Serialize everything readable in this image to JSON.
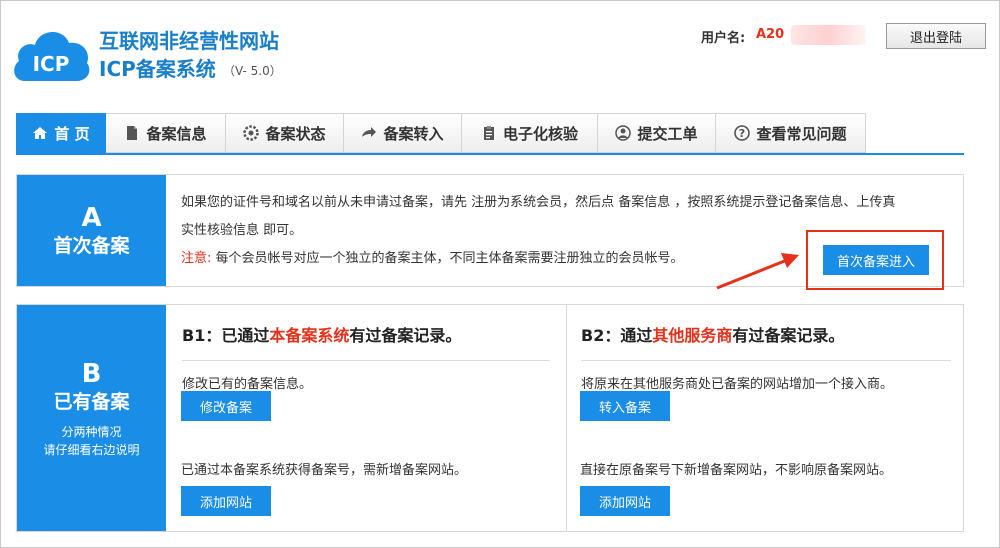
{
  "header": {
    "logo_text": "ICP",
    "site_title": "互联网非经营性网站",
    "system_title": "ICP备案系统",
    "version": "（V- 5.0）",
    "user_label": "用户名:",
    "user_value": "A20",
    "logout_label": "退出登陆"
  },
  "tabs": [
    {
      "label": "首 页",
      "icon": "home-icon"
    },
    {
      "label": "备案信息",
      "icon": "document-icon"
    },
    {
      "label": "备案状态",
      "icon": "gear-icon"
    },
    {
      "label": "备案转入",
      "icon": "arrow-right-icon"
    },
    {
      "label": "电子化核验",
      "icon": "clipboard-icon"
    },
    {
      "label": "提交工单",
      "icon": "user-icon"
    },
    {
      "label": "查看常见问题",
      "icon": "question-icon"
    }
  ],
  "section_a": {
    "letter": "A",
    "title": "首次备案",
    "line1": "如果您的证件号和域名以前从未申请过备案，请先 注册为系统会员，然后点 备案信息 ，按照系统提示登记备案信息、上传真",
    "line2": "实性核验信息 即可。",
    "note_label": "注意:",
    "note_text": " 每个会员帐号对应一个独立的备案主体，不同主体备案需要注册独立的会员帐号。",
    "button": "首次备案进入"
  },
  "section_b": {
    "letter": "B",
    "title": "已有备案",
    "note1": "分两种情况",
    "note2": "请仔细看右边说明",
    "b1": {
      "title_prefix": "B1：已通过",
      "title_highlight": "本备案系统",
      "title_suffix": "有过备案记录。",
      "desc1": "修改已有的备案信息。",
      "button1": "修改备案",
      "desc2": "已通过本备案系统获得备案号，需新增备案网站。",
      "button2": "添加网站"
    },
    "b2": {
      "title_prefix": "B2：通过",
      "title_highlight": "其他服务商",
      "title_suffix": "有过备案记录。",
      "desc1": "将原来在其他服务商处已备案的网站增加一个接入商。",
      "button1": "转入备案",
      "desc2": "直接在原备案号下新增备案网站，不影响原备案网站。",
      "button2": "添加网站"
    }
  },
  "colors": {
    "brand_blue": "#1a8de6",
    "title_blue": "#1a7fc9",
    "accent_red": "#e5301a"
  }
}
